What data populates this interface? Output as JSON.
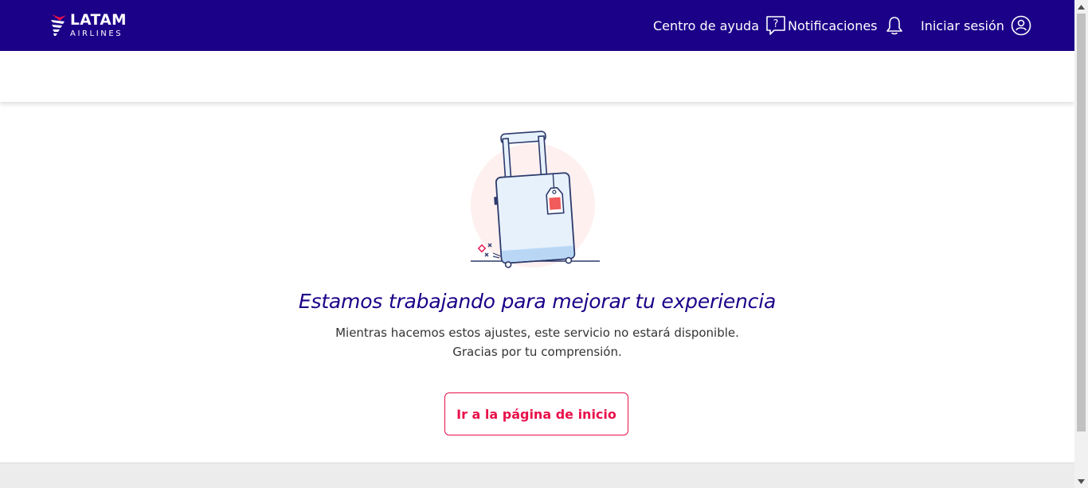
{
  "header": {
    "logo_text": "LATAM",
    "logo_subtext": "AIRLINES",
    "help_label": "Centro de ayuda",
    "notifications_label": "Notificaciones",
    "login_label": "Iniciar sesión",
    "background_color": "#1b0088"
  },
  "main": {
    "title": "Estamos trabajando para mejorar tu experiencia",
    "message_line1": "Mientras hacemos estos ajustes, este servicio no estará disponible.",
    "message_line2": "Gracias por tu comprensión.",
    "home_button_label": "Ir a la página de inicio",
    "accent_color": "#e8114b"
  },
  "icons": {
    "help": "help-chat-icon",
    "notifications": "bell-icon",
    "login": "user-icon",
    "illustration": "suitcase-illustration"
  }
}
